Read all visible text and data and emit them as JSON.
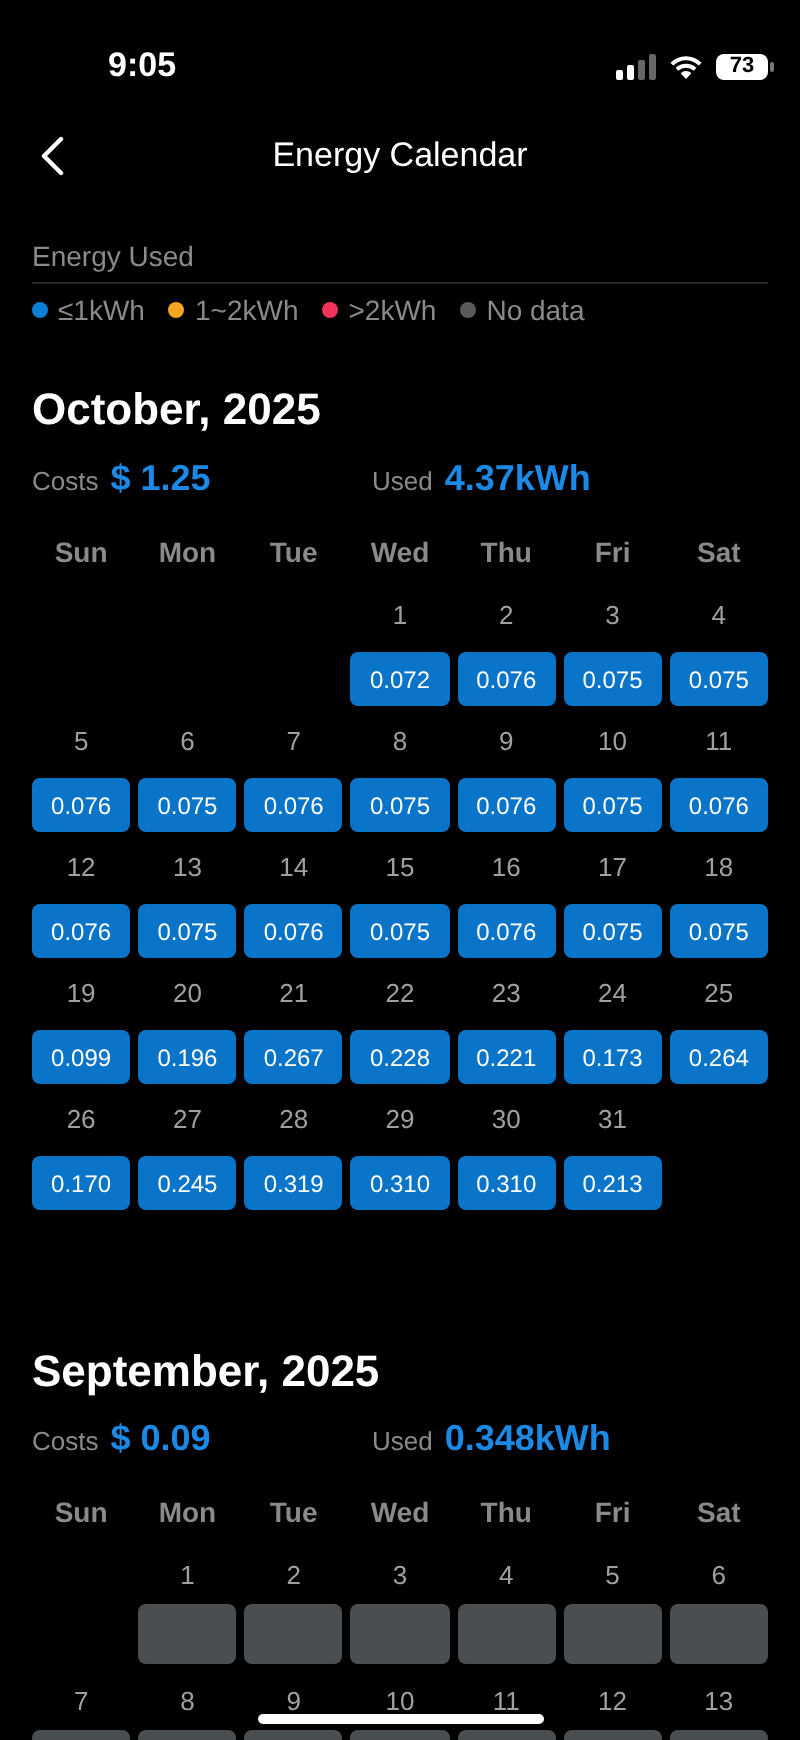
{
  "status_bar": {
    "time": "9:05",
    "battery": "73"
  },
  "nav": {
    "title": "Energy Calendar"
  },
  "legend": {
    "title": "Energy Used",
    "items": [
      {
        "label": "≤1kWh",
        "color": "#0a7fd6"
      },
      {
        "label": "1~2kWh",
        "color": "#f5a623"
      },
      {
        "label": ">2kWh",
        "color": "#f0345a"
      },
      {
        "label": "No data",
        "color": "#5a5a5a"
      }
    ]
  },
  "months": [
    {
      "title": "October, 2025",
      "costs_label": "Costs",
      "costs": "$ 1.25",
      "used_label": "Used",
      "used": "4.37kWh",
      "weekdays": [
        "Sun",
        "Mon",
        "Tue",
        "Wed",
        "Thu",
        "Fri",
        "Sat"
      ],
      "days": [
        {
          "kind": "blank"
        },
        {
          "kind": "blank"
        },
        {
          "kind": "blank"
        },
        {
          "day": "1",
          "value": "0.072",
          "kind": "low"
        },
        {
          "day": "2",
          "value": "0.076",
          "kind": "low"
        },
        {
          "day": "3",
          "value": "0.075",
          "kind": "low"
        },
        {
          "day": "4",
          "value": "0.075",
          "kind": "low"
        },
        {
          "day": "5",
          "value": "0.076",
          "kind": "low"
        },
        {
          "day": "6",
          "value": "0.075",
          "kind": "low"
        },
        {
          "day": "7",
          "value": "0.076",
          "kind": "low"
        },
        {
          "day": "8",
          "value": "0.075",
          "kind": "low"
        },
        {
          "day": "9",
          "value": "0.076",
          "kind": "low"
        },
        {
          "day": "10",
          "value": "0.075",
          "kind": "low"
        },
        {
          "day": "11",
          "value": "0.076",
          "kind": "low"
        },
        {
          "day": "12",
          "value": "0.076",
          "kind": "low"
        },
        {
          "day": "13",
          "value": "0.075",
          "kind": "low"
        },
        {
          "day": "14",
          "value": "0.076",
          "kind": "low"
        },
        {
          "day": "15",
          "value": "0.075",
          "kind": "low"
        },
        {
          "day": "16",
          "value": "0.076",
          "kind": "low"
        },
        {
          "day": "17",
          "value": "0.075",
          "kind": "low"
        },
        {
          "day": "18",
          "value": "0.075",
          "kind": "low"
        },
        {
          "day": "19",
          "value": "0.099",
          "kind": "low"
        },
        {
          "day": "20",
          "value": "0.196",
          "kind": "low"
        },
        {
          "day": "21",
          "value": "0.267",
          "kind": "low"
        },
        {
          "day": "22",
          "value": "0.228",
          "kind": "low"
        },
        {
          "day": "23",
          "value": "0.221",
          "kind": "low"
        },
        {
          "day": "24",
          "value": "0.173",
          "kind": "low"
        },
        {
          "day": "25",
          "value": "0.264",
          "kind": "low"
        },
        {
          "day": "26",
          "value": "0.170",
          "kind": "low"
        },
        {
          "day": "27",
          "value": "0.245",
          "kind": "low"
        },
        {
          "day": "28",
          "value": "0.319",
          "kind": "low"
        },
        {
          "day": "29",
          "value": "0.310",
          "kind": "low"
        },
        {
          "day": "30",
          "value": "0.310",
          "kind": "low"
        },
        {
          "day": "31",
          "value": "0.213",
          "kind": "low"
        }
      ]
    },
    {
      "title": "September, 2025",
      "costs_label": "Costs",
      "costs": "$ 0.09",
      "used_label": "Used",
      "used": "0.348kWh",
      "weekdays": [
        "Sun",
        "Mon",
        "Tue",
        "Wed",
        "Thu",
        "Fri",
        "Sat"
      ],
      "days": [
        {
          "kind": "blank"
        },
        {
          "day": "1",
          "kind": "no_data"
        },
        {
          "day": "2",
          "kind": "no_data"
        },
        {
          "day": "3",
          "kind": "no_data"
        },
        {
          "day": "4",
          "kind": "no_data"
        },
        {
          "day": "5",
          "kind": "no_data"
        },
        {
          "day": "6",
          "kind": "no_data"
        },
        {
          "day": "7",
          "kind": "no_data"
        },
        {
          "day": "8",
          "kind": "no_data"
        },
        {
          "day": "9",
          "kind": "no_data"
        },
        {
          "day": "10",
          "kind": "no_data"
        },
        {
          "day": "11",
          "kind": "no_data"
        },
        {
          "day": "12",
          "kind": "no_data"
        },
        {
          "day": "13",
          "kind": "no_data"
        }
      ]
    }
  ]
}
